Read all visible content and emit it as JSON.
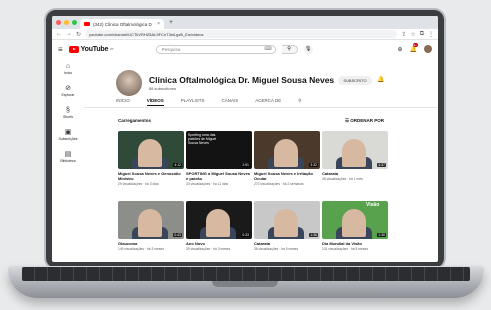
{
  "browser": {
    "tab_title": "(342) Clínica Oftalmológica D",
    "url": "youtube.com/channel/UCTkVRHZ5AL9FCnT3eiLgzB_Ew/videos",
    "new_tab": "+"
  },
  "header": {
    "logo": "YouTube",
    "logo_suffix": "PT",
    "search_placeholder": "Pesquisa",
    "notif_count": "9+"
  },
  "sidebar": {
    "items": [
      {
        "label": "Início",
        "icon": "home-icon"
      },
      {
        "label": "Explorar",
        "icon": "compass-icon"
      },
      {
        "label": "Shorts",
        "icon": "shorts-icon"
      },
      {
        "label": "Subscrições",
        "icon": "subscriptions-icon"
      },
      {
        "label": "Biblioteca",
        "icon": "library-icon"
      }
    ]
  },
  "channel": {
    "name": "Clínica Oftalmológica Dr. Miguel Sousa Neves",
    "subscribers": "88 subscritores",
    "subscribe_label": "SUBSCRITO"
  },
  "tabs": [
    "INÍCIO",
    "VÍDEOS",
    "PLAYLISTS",
    "CANAIS",
    "ACERCA DE"
  ],
  "section": {
    "title": "Carregamentos",
    "sort_label": "ORDENAR POR"
  },
  "videos": [
    {
      "title": "Miguel Sousa Neves e Genosídio Ministro",
      "meta": "29 visualizações · há 3 dias",
      "duration": "4:12",
      "thumb_color": "#2f4a39"
    },
    {
      "title": "SPORTING a Miguel Sousa Neves e paixão",
      "meta": "33 visualizações · há 11 dias",
      "duration": "2:51",
      "thumb_color": "#131313",
      "overlay": "Sporting uma das paixões de Miguel Sousa Neves"
    },
    {
      "title": "Miguel Sousa Neves e Irritação Ocular",
      "meta": "273 visualizações · há 2 semanas",
      "duration": "3:32",
      "thumb_color": "#4b3a2c"
    },
    {
      "title": "Catarata",
      "meta": "46 visualizações · há 1 mês",
      "duration": "4:37",
      "thumb_color": "#d9d9d6"
    },
    {
      "title": "Glaucoma",
      "meta": "149 visualizações · há 3 meses",
      "duration": "0:43",
      "thumb_color": "#8b8e89"
    },
    {
      "title": "Ano Novo",
      "meta": "39 visualizações · há 3 meses",
      "duration": "0:33",
      "thumb_color": "#1a1a1a"
    },
    {
      "title": "Catarata",
      "meta": "38 visualizações · há 5 meses",
      "duration": "1:36",
      "thumb_color": "#c8c8c8"
    },
    {
      "title": "Dia Mundial da Visão",
      "meta": "131 visualizações · há 5 meses",
      "duration": "1:30",
      "thumb_color": "#58a24e",
      "overlay": "Visão"
    }
  ]
}
